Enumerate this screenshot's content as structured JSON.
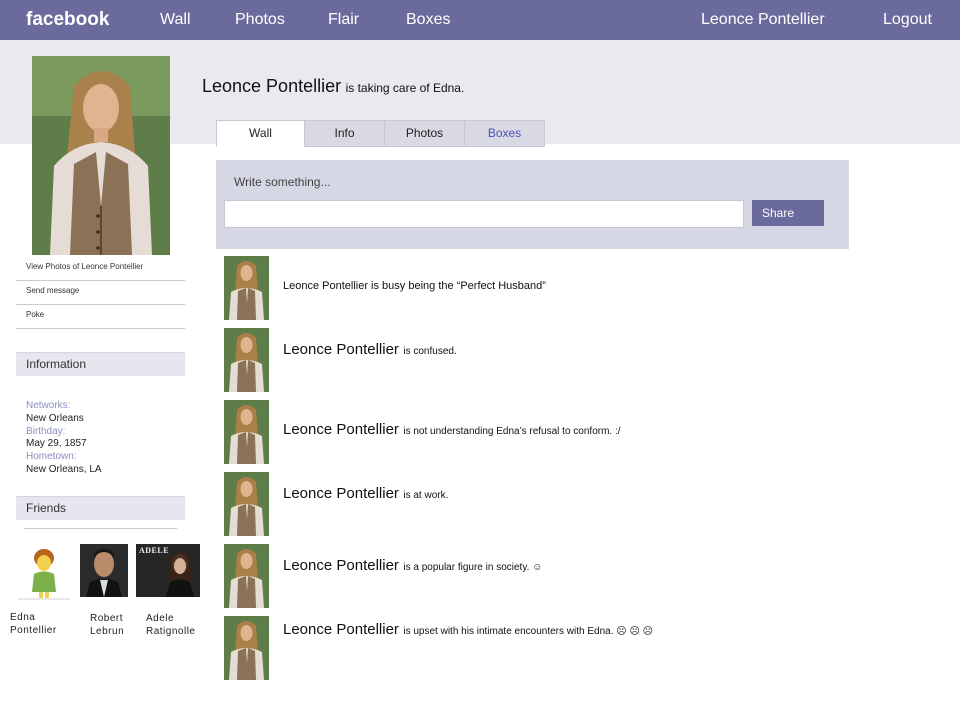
{
  "topbar": {
    "logo": "facebook",
    "nav": [
      "Wall",
      "Photos",
      "Flair",
      "Boxes"
    ],
    "user": "Leonce Pontellier",
    "logout": "Logout"
  },
  "profile": {
    "name": "Leonce Pontellier",
    "status": "is taking care of Edna."
  },
  "tabs": [
    "Wall",
    "Info",
    "Photos",
    "Boxes"
  ],
  "composer": {
    "prompt": "Write something...",
    "value": "",
    "share_label": "Share"
  },
  "posts": [
    {
      "name": "",
      "text": "Leonce Pontellier is busy being the “Perfect Husband”"
    },
    {
      "name": "Leonce Pontellier",
      "text": "is confused."
    },
    {
      "name": "Leonce Pontellier",
      "text": "is not understanding Edna’s refusal to conform. :/"
    },
    {
      "name": "Leonce Pontellier",
      "text": "is at work."
    },
    {
      "name": "Leonce Pontellier",
      "text": "is a popular figure in society. ☺"
    },
    {
      "name": "Leonce Pontellier",
      "text": "is upset with his intimate encounters with Edna. ☹ ☹ ☹"
    }
  ],
  "sidebar": {
    "links": [
      "View Photos of Leonce Pontellier",
      "Send message",
      "Poke"
    ],
    "information_title": "Information",
    "info": [
      {
        "key": "Networks:",
        "value": "New Orleans"
      },
      {
        "key": "Birthday:",
        "value": "May 29, 1857"
      },
      {
        "key": "Hometown:",
        "value": "New Orleans, LA"
      }
    ],
    "friends_title": "Friends",
    "friends": [
      {
        "first": "Edna",
        "last": "Pontellier"
      },
      {
        "first": "Robert",
        "last": "Lebrun"
      },
      {
        "first": "Adele",
        "last": "Ratignolle"
      }
    ],
    "adele_cover_text": "ADELE"
  }
}
